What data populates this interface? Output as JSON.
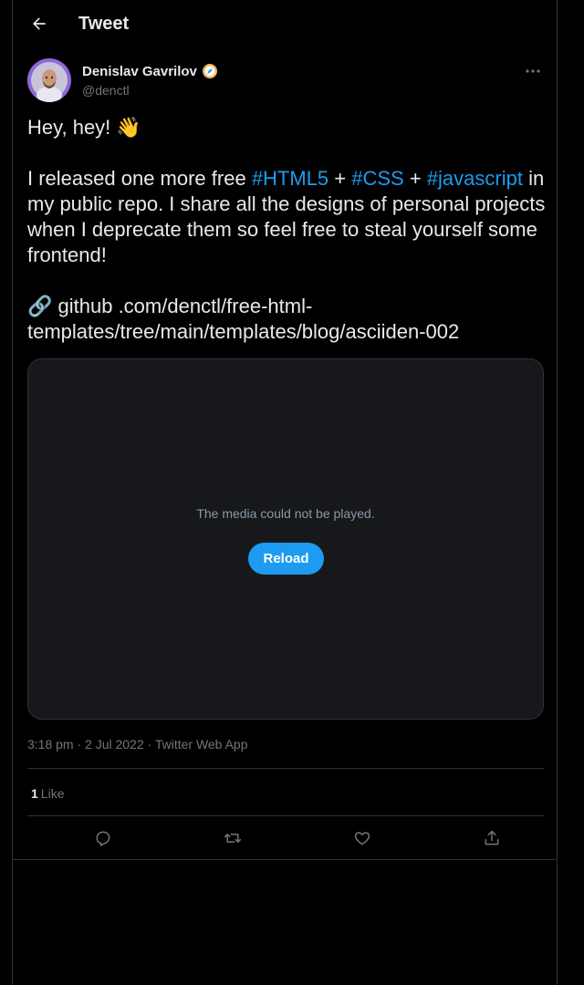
{
  "header": {
    "title": "Tweet"
  },
  "author": {
    "name": "Denislav Gavrilov",
    "handle": "@denctl",
    "badge_icon": "verified-compass-badge-icon"
  },
  "tweet": {
    "greeting": "Hey, hey! 👋",
    "line_part1": "I released one more free ",
    "hashtag1": "#HTML5",
    "plus1": " + ",
    "hashtag2": "#CSS",
    "plus2": " + ",
    "hashtag3": "#javascript",
    "line_part2": " in my public repo. I share all the designs of personal projects when I deprecate them so feel free to steal yourself some frontend!",
    "link_icon": "🔗",
    "link_text": " github .com/denctl/free-html-templates/tree/main/templates/blog/asciiden-002"
  },
  "media": {
    "message": "The media could not be played.",
    "reload_label": "Reload"
  },
  "meta": {
    "timestamp": "3:18 pm · 2 Jul 2022 · Twitter Web App"
  },
  "stats": {
    "like_count": "1",
    "like_label": "Like"
  },
  "actions": [
    "reply-icon",
    "retweet-icon",
    "like-icon",
    "share-icon"
  ],
  "colors": {
    "accent": "#1d9bf0",
    "background": "#000000",
    "muted": "#71767b"
  }
}
